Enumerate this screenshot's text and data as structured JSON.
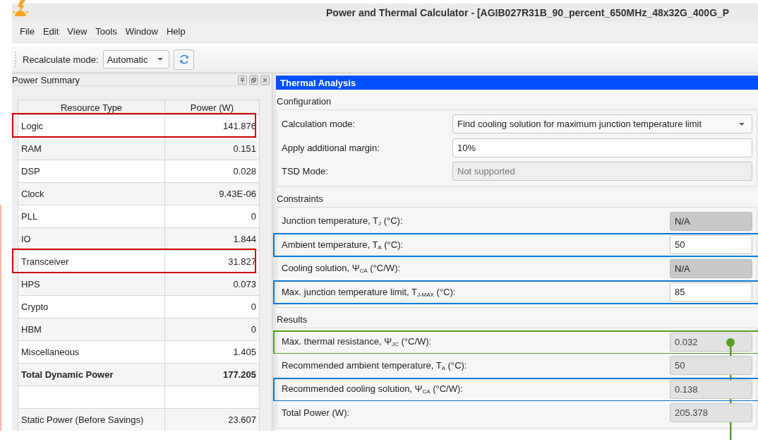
{
  "window": {
    "title": "Power and Thermal Calculator - [AGIB027R31B_90_percent_650MHz_48x32G_400G_P"
  },
  "menu": [
    "File",
    "Edit",
    "View",
    "Tools",
    "Window",
    "Help"
  ],
  "toolbar": {
    "label": "Recalculate mode:",
    "mode": "Automatic"
  },
  "power_summary": {
    "title": "Power Summary",
    "columns": [
      "Resource Type",
      "Power (W)"
    ],
    "rows": [
      {
        "kind": "item",
        "resource": "Logic",
        "power": "141.876",
        "color": "#cc0000"
      },
      {
        "kind": "item",
        "resource": "RAM",
        "power": "0.151"
      },
      {
        "kind": "item",
        "resource": "DSP",
        "power": "0.028"
      },
      {
        "kind": "item",
        "resource": "Clock",
        "power": "9.43E-06"
      },
      {
        "kind": "item",
        "resource": "PLL",
        "power": "0"
      },
      {
        "kind": "item",
        "resource": "IO",
        "power": "1.844"
      },
      {
        "kind": "item",
        "resource": "Transceiver",
        "power": "31.827",
        "color": "#cc0000"
      },
      {
        "kind": "item",
        "resource": "HPS",
        "power": "0.073"
      },
      {
        "kind": "item",
        "resource": "Crypto",
        "power": "0"
      },
      {
        "kind": "item",
        "resource": "HBM",
        "power": "0"
      },
      {
        "kind": "item",
        "resource": "Miscellaneous",
        "power": "1.405"
      },
      {
        "kind": "total",
        "resource": "Total Dynamic Power",
        "power": "177.205"
      },
      {
        "kind": "blank"
      },
      {
        "kind": "item",
        "resource": "Static Power (Before Savings)",
        "power": "23.607"
      }
    ]
  },
  "thermal_analysis": {
    "title": "Thermal Analysis",
    "sections": [
      {
        "title": "Configuration",
        "kind": "wide",
        "rows": [
          {
            "label": "Calculation mode:",
            "kind": "combo",
            "value": "Find cooling solution for maximum junction temperature limit"
          },
          {
            "label": "Apply additional margin:",
            "kind": "input",
            "value": "10%"
          },
          {
            "label": "TSD Mode:",
            "kind": "readonly",
            "value": "Not supported"
          }
        ]
      },
      {
        "title": "Constraints",
        "kind": "narrow",
        "rows": [
          {
            "label": "Junction temperature, T$_{J}$ (°C):",
            "kind": "na",
            "value": "N/A"
          },
          {
            "label": "Ambient temperature, T$_{A}$ (°C):",
            "kind": "input",
            "value": "50",
            "color": "#0a78d2"
          },
          {
            "label": "Cooling solution, Ψ$_{CA}$ (°C/W):",
            "kind": "na",
            "value": "N/A"
          },
          {
            "label": "Max. junction temperature limit, T$_{J-MAX}$ (°C):",
            "kind": "input",
            "value": "85",
            "color": "#0a78d2"
          }
        ]
      },
      {
        "title": "Results",
        "kind": "narrow",
        "rows": [
          {
            "label": "Max. thermal resistance, Ψ$_{JC}$ (°C/W):",
            "kind": "readonly",
            "value": "0.032",
            "color": "#5a9e1e",
            "leader": true
          },
          {
            "label": "Recommended ambient temperature, T$_{A}$ (°C):",
            "kind": "readonly",
            "value": "50"
          },
          {
            "label": "Recommended cooling solution, Ψ$_{CA}$ (°C/W):",
            "kind": "readonly",
            "value": "0.138",
            "color": "#0a78d2"
          },
          {
            "label": "Total Power (W):",
            "kind": "readonly",
            "value": "205.378"
          }
        ]
      }
    ]
  }
}
